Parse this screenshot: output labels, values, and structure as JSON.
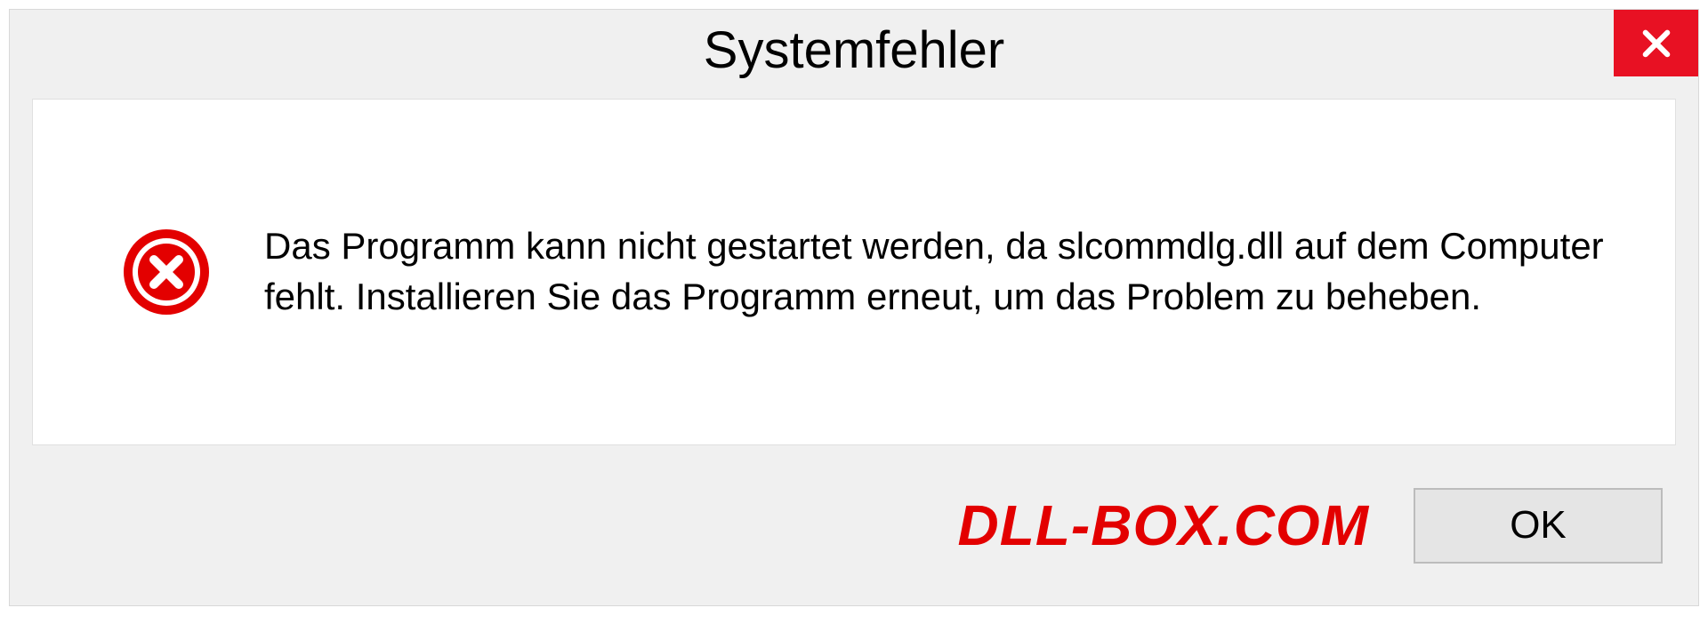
{
  "dialog": {
    "title": "Systemfehler",
    "message": "Das Programm kann nicht gestartet werden, da slcommdlg.dll auf dem Computer fehlt. Installieren Sie das Programm erneut, um das Problem zu beheben.",
    "ok_label": "OK",
    "watermark": "DLL-BOX.COM"
  }
}
